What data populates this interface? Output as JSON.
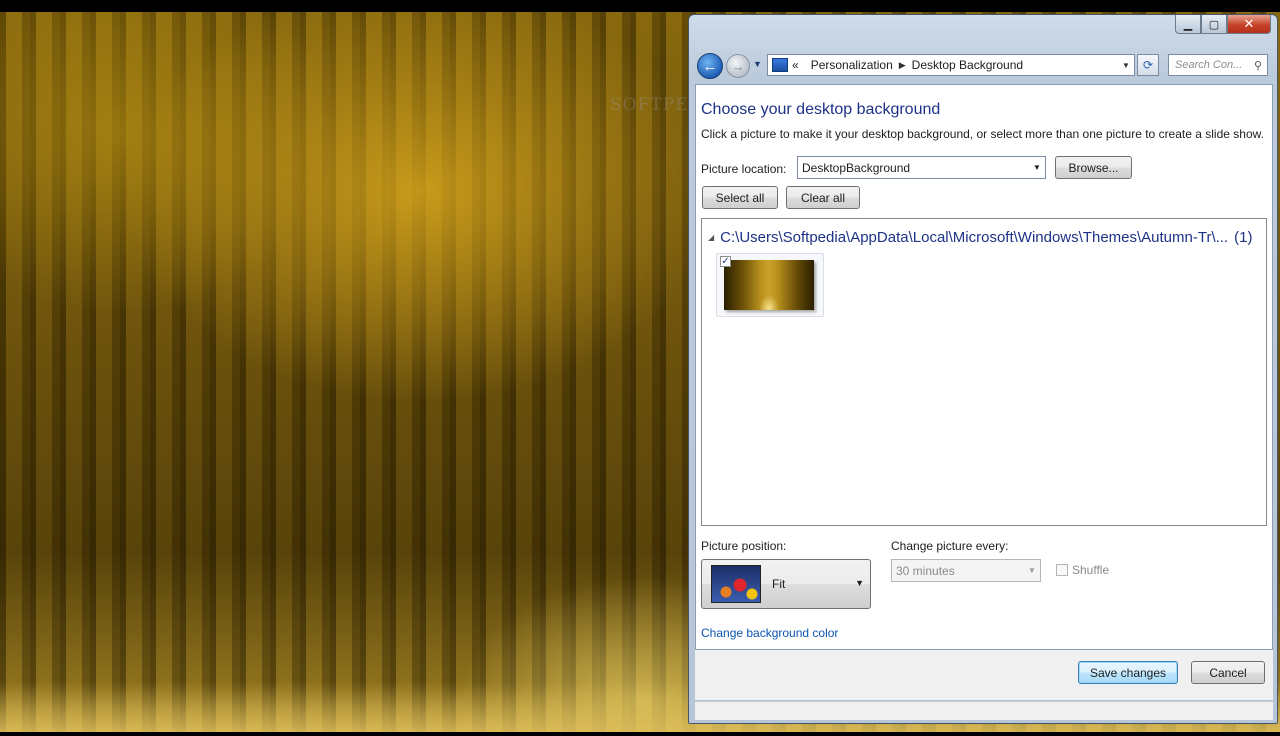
{
  "window": {
    "caption": {
      "min": "▁",
      "max": "▢",
      "close": "✕"
    }
  },
  "nav": {
    "back": "←",
    "forward": "→",
    "chevron": "«",
    "breadcrumbs": [
      "Personalization",
      "Desktop Background"
    ],
    "search_placeholder": "Search Con...",
    "refresh": "⟳",
    "search_icon": "⚲"
  },
  "page": {
    "title": "Choose your desktop background",
    "subtitle": "Click a picture to make it your desktop background, or select more than one picture to create a slide show.",
    "picture_location_label": "Picture location:",
    "picture_location_value": "DesktopBackground",
    "browse_label": "Browse...",
    "select_all_label": "Select all",
    "clear_all_label": "Clear all",
    "group": {
      "path": "C:\\Users\\Softpedia\\AppData\\Local\\Microsoft\\Windows\\Themes\\Autumn-Tr\\...",
      "count": "(1)"
    },
    "thumbnail": {
      "checked": true,
      "check_glyph": "✓"
    },
    "picture_position_label": "Picture position:",
    "picture_position_value": "Fit",
    "change_every_label": "Change picture every:",
    "change_every_value": "30 minutes",
    "shuffle_label": "Shuffle",
    "change_color_link": "Change background color",
    "save_label": "Save changes",
    "cancel_label": "Cancel"
  },
  "watermark": "SOFTPEDIA",
  "icons": {
    "dropdown": "▼",
    "breadcrumb_sep": "▶",
    "collapse": "◢"
  },
  "colors": {
    "title_blue": "#1e3287",
    "link_blue": "#0d55b2",
    "close_red": "#c6432a"
  }
}
